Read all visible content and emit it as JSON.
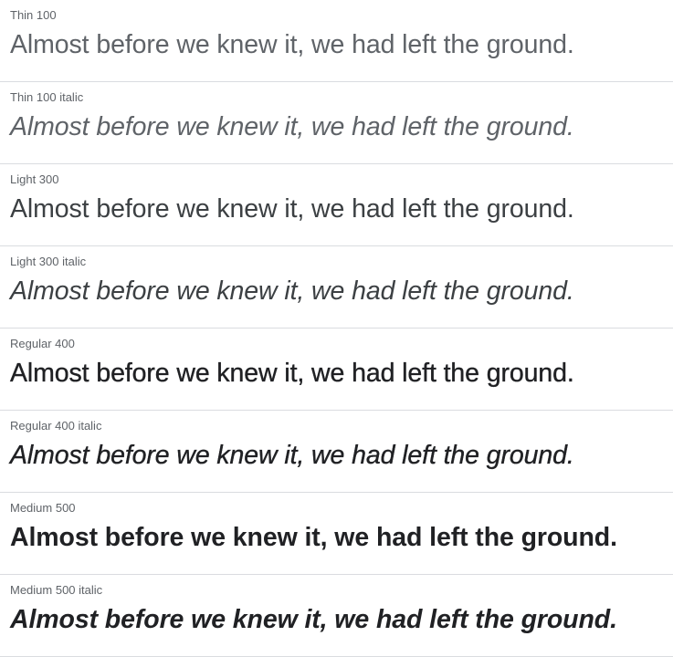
{
  "specimens": [
    {
      "label": "Thin 100",
      "sample": "Almost before we knew it, we had left the ground."
    },
    {
      "label": "Thin 100 italic",
      "sample": "Almost before we knew it, we had left the ground."
    },
    {
      "label": "Light 300",
      "sample": "Almost before we knew it, we had left the ground."
    },
    {
      "label": "Light 300 italic",
      "sample": "Almost before we knew it, we had left the ground."
    },
    {
      "label": "Regular 400",
      "sample": "Almost before we knew it, we had left the ground."
    },
    {
      "label": "Regular 400 italic",
      "sample": "Almost before we knew it, we had left the ground."
    },
    {
      "label": "Medium 500",
      "sample": "Almost before we knew it, we had left the ground."
    },
    {
      "label": "Medium 500 italic",
      "sample": "Almost before we knew it, we had left the ground."
    }
  ]
}
